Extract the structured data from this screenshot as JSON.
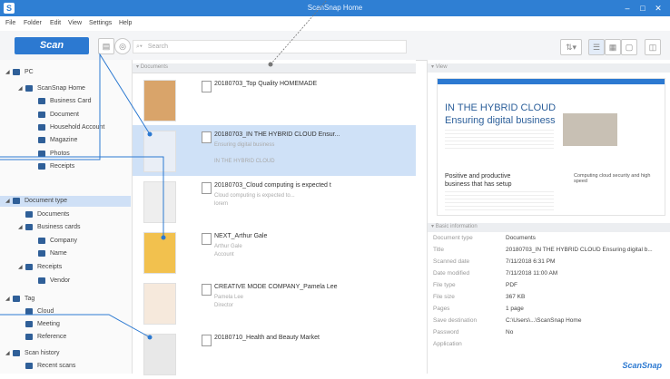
{
  "window": {
    "title": "ScanSnap Home",
    "brand": "ScanSnap"
  },
  "menu": [
    "File",
    "Folder",
    "Edit",
    "View",
    "Settings",
    "Help"
  ],
  "toolbar": {
    "scan_label": "Scan",
    "search_placeholder": "Search"
  },
  "sidebar": {
    "items": [
      {
        "label": "PC",
        "level": 0,
        "expanded": true
      },
      {
        "label": "ScanSnap Home",
        "level": 1,
        "expanded": true
      },
      {
        "label": "Business Card",
        "level": 2
      },
      {
        "label": "Document",
        "level": 2
      },
      {
        "label": "Household Account",
        "level": 2
      },
      {
        "label": "Magazine",
        "level": 2
      },
      {
        "label": "Photos",
        "level": 2
      },
      {
        "label": "Receipts",
        "level": 2
      },
      {
        "label": "Document type",
        "level": 0,
        "expanded": true,
        "selected": true
      },
      {
        "label": "Documents",
        "level": 1
      },
      {
        "label": "Business cards",
        "level": 1,
        "expanded": true
      },
      {
        "label": "Company",
        "level": 2
      },
      {
        "label": "Name",
        "level": 2
      },
      {
        "label": "Receipts",
        "level": 1,
        "expanded": true
      },
      {
        "label": "Vendor",
        "level": 2
      },
      {
        "label": "Tag",
        "level": 0,
        "expanded": true
      },
      {
        "label": "Cloud",
        "level": 1
      },
      {
        "label": "Meeting",
        "level": 1
      },
      {
        "label": "Reference",
        "level": 1
      },
      {
        "label": "Scan history",
        "level": 0,
        "expanded": true
      },
      {
        "label": "Recent scans",
        "level": 1
      }
    ]
  },
  "list": {
    "header": "Documents",
    "rows": [
      {
        "title": "20180703_Top Quality HOMEMADE",
        "lines": [],
        "selected": false
      },
      {
        "title": "20180703_IN THE HYBRID CLOUD Ensur...",
        "lines": [
          "Ensuring digital business",
          "",
          "IN THE HYBRID CLOUD"
        ],
        "selected": true
      },
      {
        "title": "20180703_Cloud computing is expected t",
        "lines": [
          "Cloud computing is expected to...",
          "lorem"
        ],
        "selected": false
      },
      {
        "title": "NEXT_Arthur Gale",
        "lines": [
          "Arthur Gale",
          "Account"
        ],
        "selected": false
      },
      {
        "title": "CREATIVE MODE COMPANY_Pamela Lee",
        "lines": [
          "Pamela Lee",
          "Director"
        ],
        "selected": false
      },
      {
        "title": "20180710_Health and Beauty Market",
        "lines": [
          "",
          ""
        ],
        "selected": false
      }
    ]
  },
  "view": {
    "header": "View",
    "preview_heading_1": "IN THE HYBRID CLOUD",
    "preview_heading_2": "Ensuring digital business",
    "preview_sub1": "Positive and productive",
    "preview_sub2": "business that has setup",
    "preview_right": "Computing cloud security and high speed"
  },
  "info": {
    "header": "Basic information",
    "rows": [
      {
        "label": "Document type",
        "value": "Documents"
      },
      {
        "label": "Title",
        "value": "20180703_IN THE HYBRID CLOUD Ensuring digital b..."
      },
      {
        "label": "Scanned date",
        "value": "7/11/2018 6:31 PM"
      },
      {
        "label": "Date modified",
        "value": "7/11/2018 11:00 AM"
      },
      {
        "label": "File type",
        "value": "PDF"
      },
      {
        "label": "File size",
        "value": "367 KB"
      },
      {
        "label": "Pages",
        "value": "1 page"
      },
      {
        "label": "Save destination",
        "value": "C:\\Users\\...\\ScanSnap Home"
      },
      {
        "label": "Password",
        "value": "No"
      },
      {
        "label": "Application",
        "value": ""
      }
    ]
  }
}
